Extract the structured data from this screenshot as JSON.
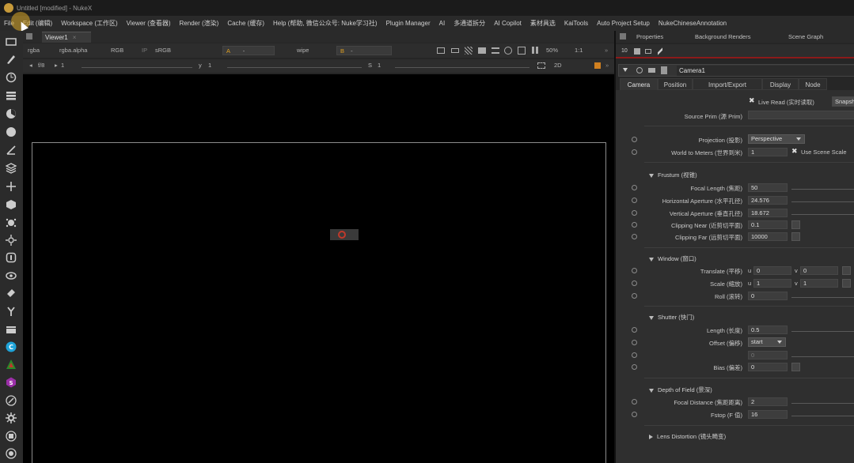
{
  "window": {
    "title": "Untitled [modified] - NukeX"
  },
  "menubar": [
    "File",
    "Edit (编辑)",
    "Workspace (工作区)",
    "Viewer (查看器)",
    "Render (渲染)",
    "Cache (缓存)",
    "Help (帮助, 微信公众号: Nuke学习社)",
    "Plugin Manager",
    "AI",
    "多通道拆分",
    "AI Copilot",
    "素材具选",
    "KaiTools",
    "Auto Project Setup",
    "NukeChineseAnnotation"
  ],
  "viewer": {
    "tab_label": "Viewer1",
    "channels": "rgba",
    "alpha": "rgba.alpha",
    "display": "RGB",
    "ip": "IP",
    "colorspace": "sRGB",
    "input_a": "A",
    "input_a_value": "-",
    "wipe": "wipe",
    "input_b": "B",
    "input_b_value": "-",
    "zoom": "50%",
    "ratio": "1:1",
    "fstop": "f/8",
    "frame": "1",
    "y_label": "y",
    "y_value": "1",
    "s_label": "S",
    "s_value": "1",
    "view_mode": "2D"
  },
  "properties": {
    "tabs": [
      "Properties",
      "Background Renders",
      "Scene Graph"
    ],
    "max_panels": "10",
    "node_name": "Camera1",
    "node_tabs": [
      "Camera",
      "Position",
      "Import/Export",
      "Display",
      "Node"
    ],
    "live_read_label": "Live Read (实时读取)",
    "snapshot_label": "Snapsh",
    "source_prim_label": "Source Prim (源 Prim)",
    "source_prim_value": "",
    "projection_label": "Projection (投影)",
    "projection_value": "Perspective",
    "world_to_meters_label": "World to Meters (世界到米)",
    "world_to_meters_value": "1",
    "use_scene_scale_label": "Use Scene Scale",
    "frustum": {
      "title": "Frustum (视锥)",
      "focal_length_label": "Focal Length (焦距)",
      "focal_length_value": "50",
      "h_aperture_label": "Horizontal Aperture (水平孔径)",
      "h_aperture_value": "24.576",
      "v_aperture_label": "Vertical Aperture (垂直孔径)",
      "v_aperture_value": "18.672",
      "near_label": "Clipping Near (近剪切平面)",
      "near_value": "0.1",
      "far_label": "Clipping Far (远剪切平面)",
      "far_value": "10000"
    },
    "window_sec": {
      "title": "Window (窗口)",
      "translate_label": "Translate (平移)",
      "translate_u": "0",
      "translate_v": "0",
      "scale_label": "Scale (缩放)",
      "scale_u": "1",
      "scale_v": "1",
      "roll_label": "Roll (滚转)",
      "roll_value": "0",
      "u_label": "u",
      "v_label": "v"
    },
    "shutter": {
      "title": "Shutter (快门)",
      "length_label": "Length (长度)",
      "length_value": "0.5",
      "offset_label": "Offset (偏移)",
      "offset_value": "start",
      "custom_value": "0",
      "bias_label": "Bias (偏差)",
      "bias_value": "0"
    },
    "dof": {
      "title": "Depth of Field (景深)",
      "focal_distance_label": "Focal Distance (焦距距离)",
      "focal_distance_value": "2",
      "fstop_label": "Fstop (F 值)",
      "fstop_value": "16"
    },
    "lens_distortion": {
      "title": "Lens Distortion (镜头畸变)"
    }
  },
  "colors": {
    "accent": "#c79a3a",
    "canvas": "#000000",
    "panel": "#2f2f2f"
  }
}
